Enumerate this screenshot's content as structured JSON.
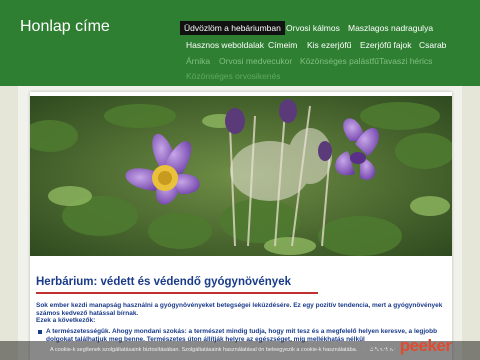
{
  "header": {
    "site_title": "Honlap címe"
  },
  "nav": {
    "items": [
      {
        "label": "Üdvözlöm a hebáriumban",
        "active": true
      },
      {
        "label": "Orvosi kálmos"
      },
      {
        "label": "Maszlagos nadragulya"
      },
      {
        "label": "Hasznos weboldalak"
      },
      {
        "label": "Címeim"
      },
      {
        "label": "Kis ezerjófű"
      },
      {
        "label": "Ezerjófű fajok"
      },
      {
        "label": "Csarab"
      },
      {
        "label": "Árnika"
      },
      {
        "label": "Orvosi medvecukor"
      },
      {
        "label": "Közönséges palástfű"
      },
      {
        "label": "Tavaszi hérics"
      },
      {
        "label": "Közönséges orvosikenés"
      }
    ]
  },
  "article": {
    "title": "Herbárium: védett és védendő gyógynövények",
    "p1": "Sok ember kezdi manapság használni a gyógynövényeket betegségei lekúzdésére. Ez egy pozitív tendencia, mert a gyógynövények számos kedvező hatással bírnak.",
    "p2": "Ezek a következők:",
    "bullet": "A természetességük. Ahogy mondani szokás: a természet mindig tudja, hogy mit tesz és a megfelelő helyen keresve, a legjobb dolgokat találhatjuk meg benne. Természetes úton állítják helyre az egészséget, míg mellékhatás nélkül"
  },
  "cookie_bar": {
    "text": "A cookie-k segítenek szolgáltatásaink biztosításában. Szolgáltatásaink használatával ön beleegyezik a cookie-k használatába.",
    "link": "Bővebben"
  },
  "watermark": {
    "part1": "page",
    "part2": "peeker"
  }
}
